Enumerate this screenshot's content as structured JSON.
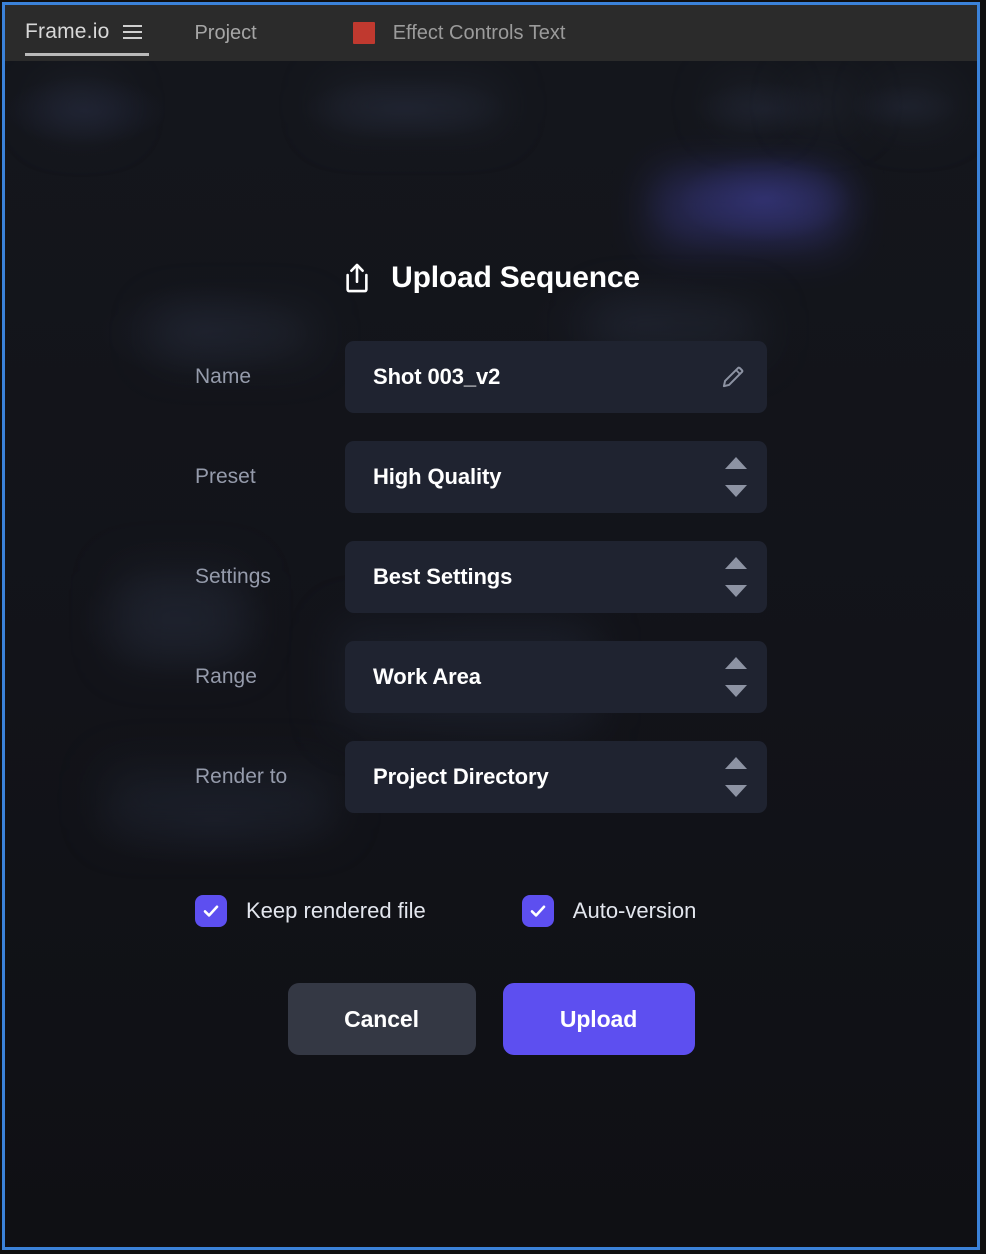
{
  "window": {
    "border_color": "#3b82d9",
    "background_color": "#14161c"
  },
  "menubar": {
    "brand": "Frame.io",
    "menu_icon": "hamburger-icon",
    "project_label": "Project",
    "panel_swatch_color": "#c0392f",
    "panel_tab_label": "Effect Controls Text"
  },
  "modal": {
    "icon": "upload-icon",
    "title": "Upload Sequence",
    "rows": [
      {
        "label": "Name",
        "value": "Shot 003_v2",
        "control": "text-input",
        "icon": "pencil-icon"
      },
      {
        "label": "Preset",
        "value": "High Quality",
        "control": "stepper-select",
        "icon": "stepper-arrows-icon"
      },
      {
        "label": "Settings",
        "value": "Best Settings",
        "control": "stepper-select",
        "icon": "stepper-arrows-icon"
      },
      {
        "label": "Range",
        "value": "Work Area",
        "control": "stepper-select",
        "icon": "stepper-arrows-icon"
      },
      {
        "label": "Render to",
        "value": "Project Directory",
        "control": "stepper-select",
        "icon": "stepper-arrows-icon"
      }
    ],
    "checkboxes": [
      {
        "label": "Keep rendered file",
        "checked": true
      },
      {
        "label": "Auto-version",
        "checked": true
      }
    ],
    "buttons": {
      "cancel": "Cancel",
      "upload": "Upload"
    },
    "accent_color": "#5d4ff0",
    "field_background": "#1f2330",
    "label_color": "#959bab"
  }
}
